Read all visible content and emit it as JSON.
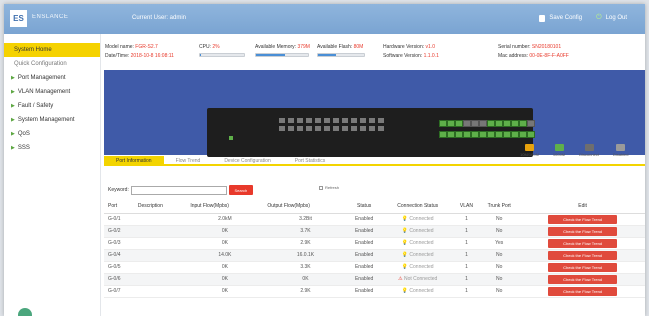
{
  "header": {
    "logo_mark": "ES",
    "brand": "ENSLANCE",
    "current_user": "Current User: admin",
    "save_config": "Save Config",
    "log_out": "Log Out"
  },
  "sidebar": {
    "items": [
      {
        "label": "System Home",
        "type": "active"
      },
      {
        "label": "Quick Configuration",
        "type": "quick"
      },
      {
        "label": "Port Management",
        "type": "menu"
      },
      {
        "label": "VLAN Management",
        "type": "menu"
      },
      {
        "label": "Fault / Safety",
        "type": "menu"
      },
      {
        "label": "System Management",
        "type": "menu"
      },
      {
        "label": "QoS",
        "type": "menu"
      },
      {
        "label": "SSS",
        "type": "menu"
      }
    ]
  },
  "device": {
    "model_label": "Model name:",
    "model_value": "FGR-S2.7",
    "cpu_label": "CPU:",
    "cpu_value": "2%",
    "cpu_level": 0.02,
    "memory_label": "Available Memory:",
    "memory_value": "379M",
    "memory_level": 0.55,
    "flash_label": "Available Flash:",
    "flash_value": "80M",
    "flash_level": 0.4,
    "hw_label": "Hardware Version:",
    "hw_value": "v1.0",
    "serial_label": "Serial number:",
    "serial_value": "SN20180101",
    "date_label": "Date/Time:",
    "date_value": "2018-10-8 16:08:11",
    "sw_label": "Software Version:",
    "sw_value": "1.1.0.1",
    "mac_label": "Mac address:",
    "mac_value": "00-0E-8F-F-A0FF"
  },
  "legend": [
    {
      "label": "10M/100M",
      "color": "#e8a20c"
    },
    {
      "label": "1000M",
      "color": "#5fb04a"
    },
    {
      "label": "Disconnect",
      "color": "#6e6e6e"
    },
    {
      "label": "Disabled",
      "color": "#9a9a9a"
    }
  ],
  "tabs": [
    {
      "label": "Port Information",
      "active": true
    },
    {
      "label": "Flow Trend",
      "active": false
    },
    {
      "label": "Device Configuration",
      "active": false
    },
    {
      "label": "Port Statistics",
      "active": false
    }
  ],
  "search": {
    "label": "Keyword:",
    "placeholder": "",
    "button": "Search",
    "refresh_label": "Refresh"
  },
  "table": {
    "headers": [
      "Port",
      "Description",
      "Input Flow(Mpbs)",
      "Output Flow(Mpbs)",
      "Status",
      "Connection Status",
      "VLAN",
      "Trunk Port",
      "Edit"
    ],
    "rows": [
      {
        "port": "G-0/1",
        "desc": "",
        "in": "2.0kM",
        "out": "3.2Bit",
        "status": "Enabled",
        "conn": "Connected",
        "ok": true,
        "vlan": "1",
        "trunk": "No",
        "action": "Check the Flow Trend"
      },
      {
        "port": "G-0/2",
        "desc": "",
        "in": "0K",
        "out": "3.7K",
        "status": "Enabled",
        "conn": "Connected",
        "ok": true,
        "vlan": "1",
        "trunk": "No",
        "action": "Check the Flow Trend"
      },
      {
        "port": "G-0/3",
        "desc": "",
        "in": "0K",
        "out": "2.9K",
        "status": "Enabled",
        "conn": "Connected",
        "ok": true,
        "vlan": "1",
        "trunk": "Yes",
        "action": "Check the Flow Trend"
      },
      {
        "port": "G-0/4",
        "desc": "",
        "in": "14.0K",
        "out": "16.0.1K",
        "status": "Enabled",
        "conn": "Connected",
        "ok": true,
        "vlan": "1",
        "trunk": "No",
        "action": "Check the Flow Trend"
      },
      {
        "port": "G-0/5",
        "desc": "",
        "in": "0K",
        "out": "3.3K",
        "status": "Enabled",
        "conn": "Connected",
        "ok": true,
        "vlan": "1",
        "trunk": "No",
        "action": "Check the Flow Trend"
      },
      {
        "port": "G-0/6",
        "desc": "",
        "in": "0K",
        "out": "0K",
        "status": "Enabled",
        "conn": "Not Connected",
        "ok": false,
        "vlan": "1",
        "trunk": "No",
        "action": "Check the Flow Trend"
      },
      {
        "port": "G-0/7",
        "desc": "",
        "in": "0K",
        "out": "2.9K",
        "status": "Enabled",
        "conn": "Connected",
        "ok": true,
        "vlan": "1",
        "trunk": "No",
        "action": "Check the Flow Trend"
      }
    ]
  }
}
